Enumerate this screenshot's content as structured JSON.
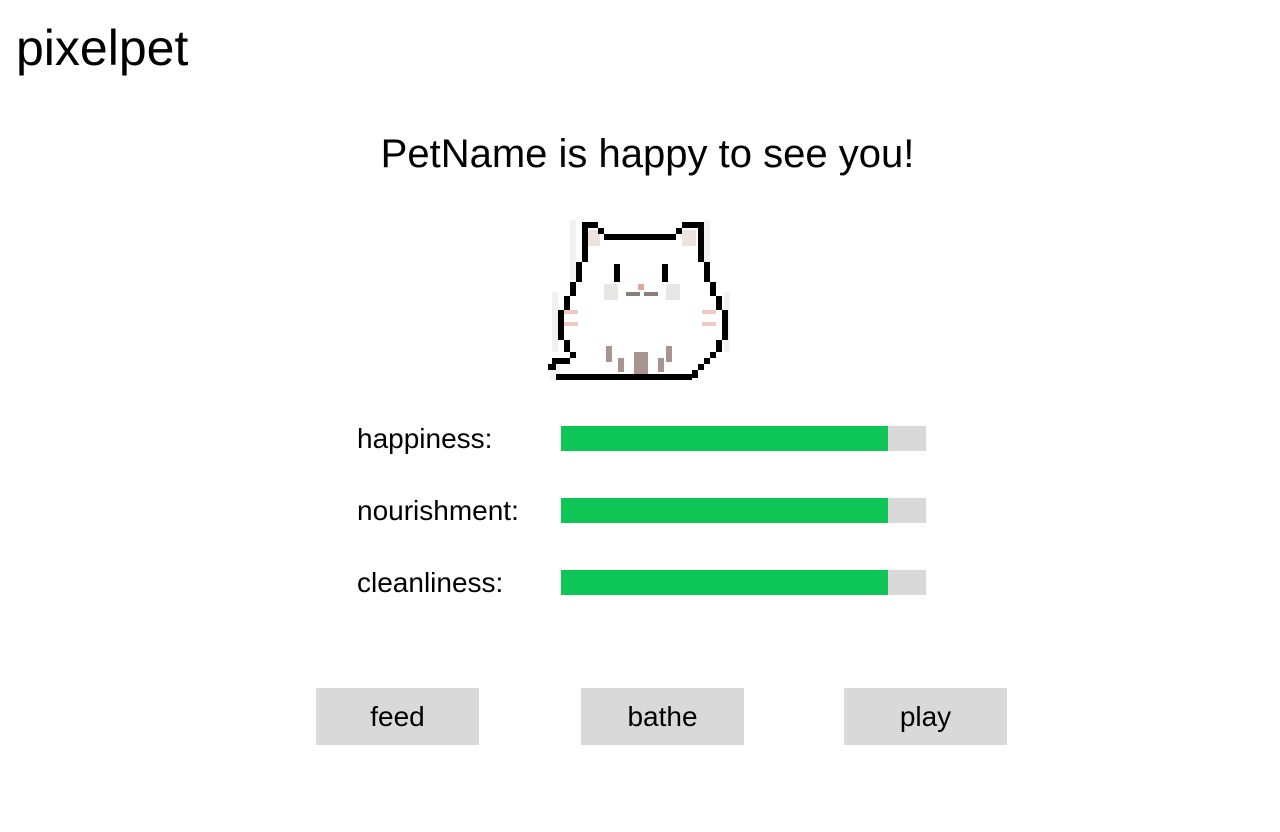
{
  "app": {
    "title": "pixelpet"
  },
  "greeting": "PetName is happy to see you!",
  "pet": {
    "sprite_icon": "pixel-cat-icon"
  },
  "colors": {
    "bar_fill": "#0dc655",
    "bar_track": "#d9d9d9",
    "button_bg": "#d9d9d9"
  },
  "stats": [
    {
      "label": "happiness:",
      "level": 0.896
    },
    {
      "label": "nourishment:",
      "level": 0.896
    },
    {
      "label": "cleanliness:",
      "level": 0.896
    }
  ],
  "actions": [
    {
      "label": "feed"
    },
    {
      "label": "bathe"
    },
    {
      "label": "play"
    }
  ]
}
